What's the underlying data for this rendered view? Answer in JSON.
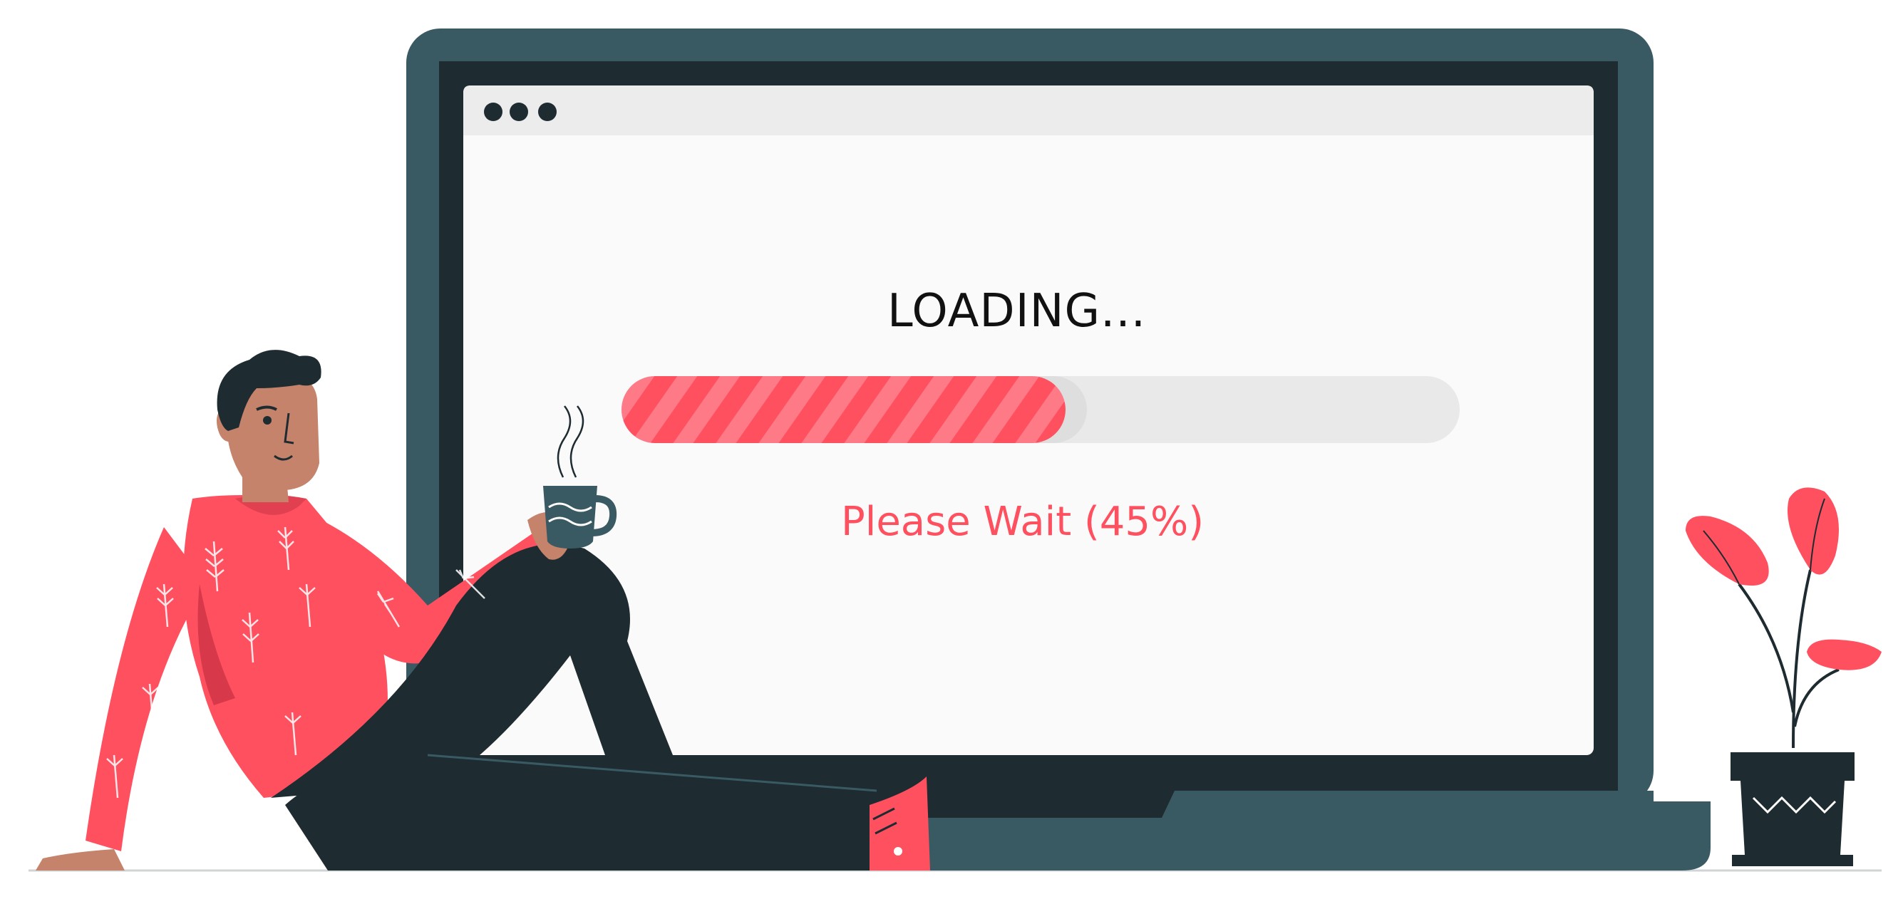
{
  "screen": {
    "title": "LOADING...",
    "status_text": "Please Wait (45%)",
    "progress": 0.53
  },
  "window": {
    "dots": [
      "dot",
      "dot",
      "dot"
    ]
  },
  "colors": {
    "frame": "#3a5a63",
    "bezel": "#1e2b30",
    "accent": "#ff5060",
    "accent_light": "#ff7a87",
    "track": "#e9e9e9",
    "screen_bg": "#fafafa",
    "titlebar": "#ececec",
    "dark": "#1e2b30"
  },
  "icons": {
    "laptop": "laptop-icon",
    "person": "person-illustration",
    "mug": "coffee-mug-icon",
    "plant": "potted-plant-icon"
  }
}
